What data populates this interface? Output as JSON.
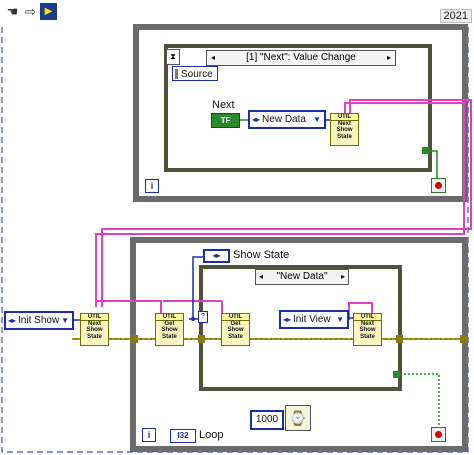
{
  "toolbar": {
    "icons": [
      "hand-icon",
      "arrow-icon",
      "labview-icon"
    ],
    "version": "2021"
  },
  "event_structure": {
    "selector": "[1] \"Next\": Value Change",
    "left_arrow": "◂",
    "right_arrow": "▸",
    "terminal": "Source",
    "next_label": "Next",
    "next_bool": "TF",
    "new_data_value": "New Data",
    "subvi": [
      "UTIL",
      "Next",
      "Show",
      "State"
    ],
    "iteration": "i"
  },
  "loop": {
    "init_show": "Init Show",
    "show_state_label": "Show State",
    "case_selector": "\"New Data\"",
    "left_arrow": "◂",
    "right_arrow": "▸",
    "init_view": "Init View",
    "subvi_next_1": [
      "UTIL",
      "Next",
      "Show",
      "State"
    ],
    "subvi_get_1": [
      "UTIL",
      "Get",
      "Show",
      "State"
    ],
    "subvi_get_2": [
      "UTIL",
      "Get",
      "Show",
      "State"
    ],
    "subvi_next_2": [
      "UTIL",
      "Next",
      "Show",
      "State"
    ],
    "wait_value": "1000",
    "iteration": "i",
    "loop_label": "Loop",
    "i32": "I32"
  },
  "colors": {
    "pink": "#e040c8",
    "cluster": "#7a6a10",
    "blue": "#1a2ea8",
    "green": "#2a8a2a",
    "frame": "#6b6b6b"
  }
}
